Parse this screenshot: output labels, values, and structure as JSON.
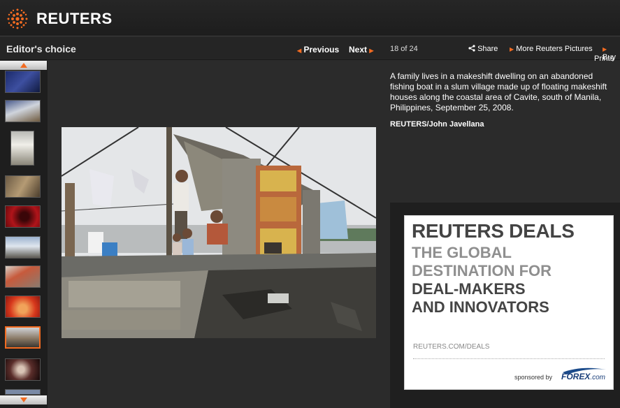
{
  "header": {
    "brand": "REUTERS"
  },
  "nav": {
    "section_title": "Editor's choice",
    "previous_label": "Previous",
    "next_label": "Next",
    "counter": "18 of 24",
    "share_label": "Share",
    "more_pictures_label": "More Reuters Pictures",
    "buy_prints_label_1": "Buy",
    "buy_prints_label_2": "Prints"
  },
  "caption": {
    "text": "A family lives in a makeshift dwelling on an abandoned fishing boat in a slum village made up of floating makeshift houses along the coastal area of Cavite, south of Manila, Philippines, September 25, 2008.",
    "credit": "REUTERS/John Javellana"
  },
  "ad": {
    "headline": "REUTERS DEALS",
    "line1": "THE GLOBAL",
    "line2": "DESTINATION FOR",
    "line3": "DEAL-MAKERS",
    "line4": "AND INNOVATORS",
    "url": "REUTERS.COM/DEALS",
    "sponsored_by": "sponsored by",
    "sponsor": "FOREX",
    "sponsor_suffix": ".com"
  },
  "colors": {
    "accent": "#f26b21",
    "background": "#2b2b2b"
  },
  "icons": {
    "share": "share-icon",
    "arrow_up": "arrow-up-icon",
    "arrow_down": "arrow-down-icon"
  }
}
